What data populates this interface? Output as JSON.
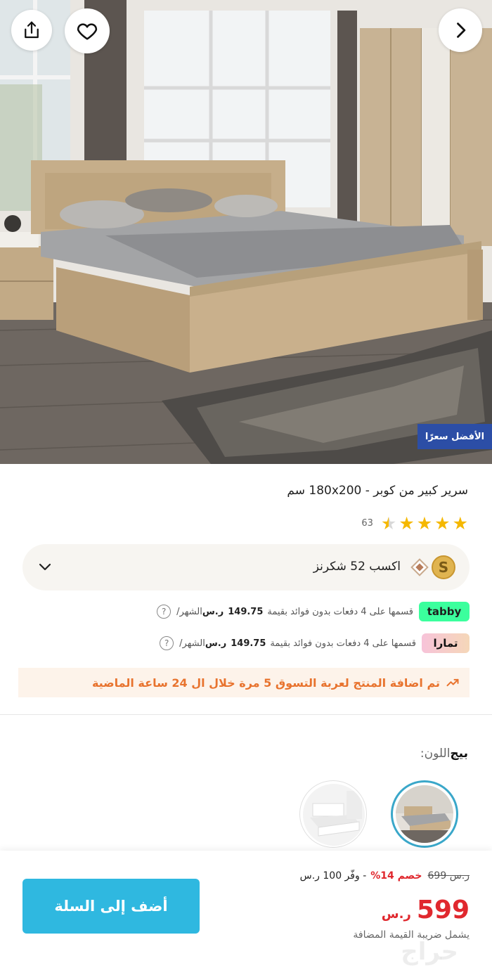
{
  "hero": {
    "badge": "الأفضل سعرًا",
    "share_icon": "share-icon",
    "favorite_icon": "heart-icon",
    "next_icon": "chevron-right-icon"
  },
  "product": {
    "title": "سرير كبير من كوبر - 180x200 سم",
    "rating": {
      "stars": 4.5,
      "count": "63"
    }
  },
  "points": {
    "coin_letter": "S",
    "label": "اكسب 52 شكرنز"
  },
  "installments": [
    {
      "provider": "tabby",
      "logo_text": "tabby",
      "text": "قسمها على 4 دفعات بدون فوائد بقيمة",
      "amount": "149.75",
      "currency": "ر.س",
      "period": "/الشهر",
      "help": "?"
    },
    {
      "provider": "tamara",
      "logo_text": "تمارا",
      "text": "قسمها على 4 دفعات بدون فوائد بقيمة",
      "amount": "149.75",
      "currency": "ر.س",
      "period": "/الشهر",
      "help": "?"
    }
  ],
  "trend": {
    "text": "تم اضافة المنتج لعربة التسوق 5 مرة خلال ال 24 ساعة الماضية"
  },
  "color": {
    "key": "اللون:",
    "value": "بيج"
  },
  "bottom": {
    "add_to_cart": "أضف إلى السلة",
    "old_price": "699 ر.س",
    "discount": "خصم 14%",
    "save": "- وفّر 100 ر.س",
    "price": "599",
    "currency": "ر.س",
    "vat_note": "يشمل ضريبة القيمة المضافة",
    "watermark": "حراج"
  },
  "colors": {
    "accent": "#2fb8e0",
    "sale": "#e0282e",
    "badge": "#2c4ea6",
    "trend": "#e8732e",
    "star": "#f5b800"
  }
}
